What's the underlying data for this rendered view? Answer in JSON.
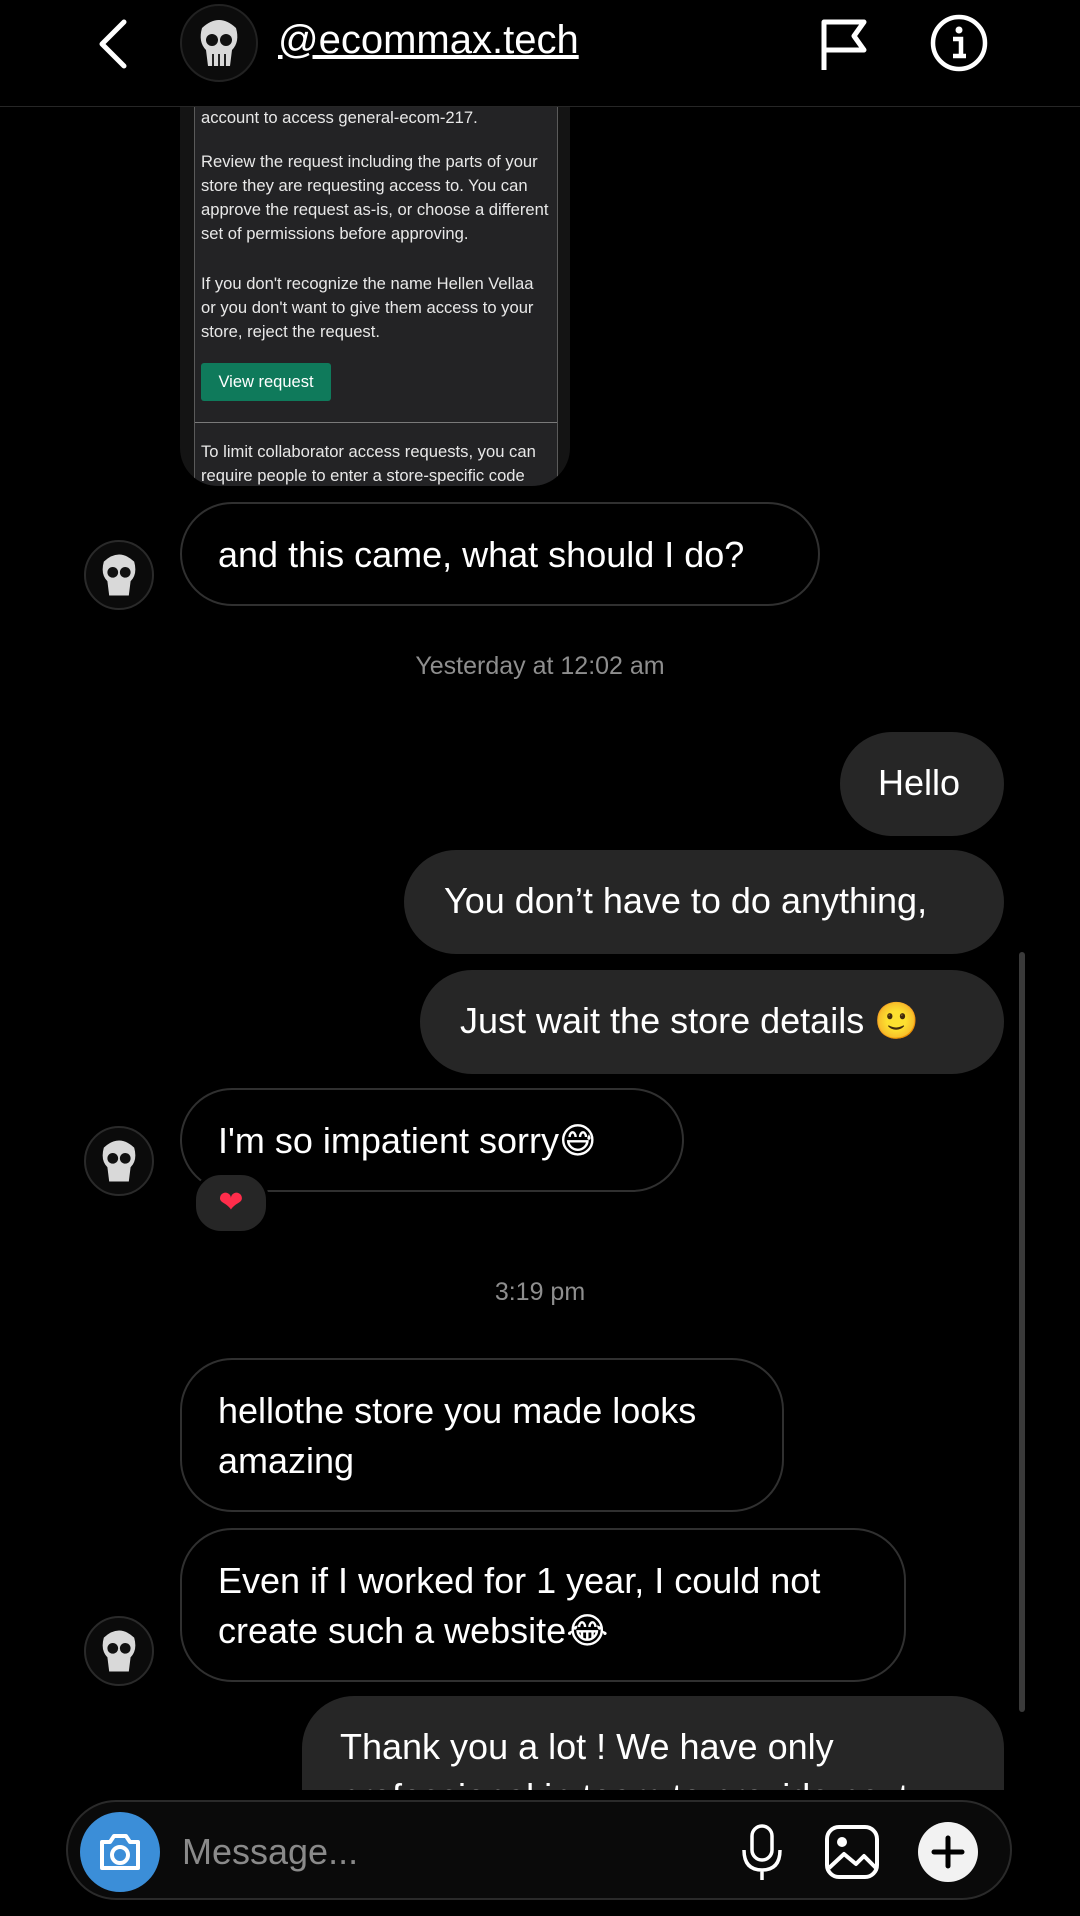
{
  "header": {
    "handle": "@ecommax.tech",
    "back_icon": "chevron-left-icon",
    "flag_icon": "flag-icon",
    "info_icon": "info-icon"
  },
  "attachment": {
    "line1": "account to access general-ecom-217.",
    "p2": "Review the request including the parts of your store they are requesting access to. You can approve the request as-is, or choose a different set of permissions before approving.",
    "p3": "If you don't recognize the name Hellen Vellaa or you don't want to give them access to your store, reject the request.",
    "button": "View request",
    "p4": "To limit collaborator access requests, you can require people to enter a store-specific code",
    "button_color": "#0f7a5b"
  },
  "messages": {
    "m1": "and this came, what should I do?",
    "ts1": "Yesterday at 12:02 am",
    "m2": "Hello",
    "m3": "You don’t have to do anything,",
    "m4": "Just wait the store details 🙂",
    "m5": "I'm so impatient sorry😅",
    "reaction": "❤",
    "ts2": "3:19 pm",
    "m6": "hellothe store you made looks amazing",
    "m7": "Even if I worked for 1 year, I could not create such a website😂",
    "m8": "Thank you a lot ! We have only professional in team to provide next"
  },
  "composer": {
    "placeholder": "Message...",
    "camera_icon": "camera-icon",
    "mic_icon": "microphone-icon",
    "gallery_icon": "gallery-icon",
    "plus_icon": "plus-icon",
    "camera_color": "#3b8ed8"
  }
}
